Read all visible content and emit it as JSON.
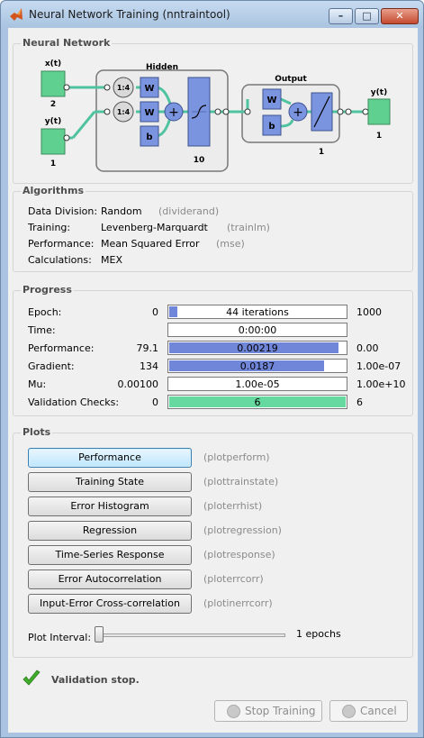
{
  "window": {
    "title": "Neural Network Training (nntraintool)",
    "controls": {
      "minimize": "–",
      "maximize": "□",
      "close": "✕"
    }
  },
  "neural_network": {
    "section_title": "Neural Network",
    "inputs": [
      {
        "label": "x(t)",
        "size": "2"
      },
      {
        "label": "y(t)",
        "size": "1"
      }
    ],
    "hidden": {
      "title": "Hidden",
      "delays": [
        "1:4",
        "1:4"
      ],
      "weight_label": "W",
      "bias_label": "b",
      "size": "10"
    },
    "output_layer": {
      "title": "Output",
      "weight_label": "W",
      "bias_label": "b",
      "size": "1"
    },
    "output": {
      "label": "y(t)",
      "size": "1"
    },
    "colors": {
      "node_green": "#5fd08f",
      "block_blue": "#7b94e0",
      "line_teal": "#4fc3a0"
    }
  },
  "algorithms": {
    "section_title": "Algorithms",
    "rows": [
      {
        "label": "Data Division:",
        "value": "Random",
        "fn": "(dividerand)"
      },
      {
        "label": "Training:",
        "value": "Levenberg-Marquardt",
        "fn": "(trainlm)"
      },
      {
        "label": "Performance:",
        "value": "Mean Squared Error",
        "fn": "(mse)"
      },
      {
        "label": "Calculations:",
        "value": "MEX",
        "fn": ""
      }
    ]
  },
  "progress": {
    "section_title": "Progress",
    "rows": [
      {
        "label": "Epoch:",
        "start": "0",
        "bar_text": "44 iterations",
        "fill": 0.045,
        "end": "1000",
        "color": "blue"
      },
      {
        "label": "Time:",
        "start": "",
        "bar_text": "0:00:00",
        "fill": 0,
        "end": "",
        "color": "blue"
      },
      {
        "label": "Performance:",
        "start": "79.1",
        "bar_text": "0.00219",
        "fill": 0.96,
        "end": "0.00",
        "color": "blue"
      },
      {
        "label": "Gradient:",
        "start": "134",
        "bar_text": "0.0187",
        "fill": 0.88,
        "end": "1.00e-07",
        "color": "blue"
      },
      {
        "label": "Mu:",
        "start": "0.00100",
        "bar_text": "1.00e-05",
        "fill": 0,
        "end": "1.00e+10",
        "color": "blue"
      },
      {
        "label": "Validation Checks:",
        "start": "0",
        "bar_text": "6",
        "fill": 1.0,
        "end": "6",
        "color": "green"
      }
    ]
  },
  "plots": {
    "section_title": "Plots",
    "buttons": [
      {
        "label": "Performance",
        "fn": "(plotperform)"
      },
      {
        "label": "Training State",
        "fn": "(plottrainstate)"
      },
      {
        "label": "Error Histogram",
        "fn": "(ploterrhist)"
      },
      {
        "label": "Regression",
        "fn": "(plotregression)"
      },
      {
        "label": "Time-Series Response",
        "fn": "(plotresponse)"
      },
      {
        "label": "Error Autocorrelation",
        "fn": "(ploterrcorr)"
      },
      {
        "label": "Input-Error Cross-correlation",
        "fn": "(plotinerrcorr)"
      }
    ],
    "interval_label": "Plot Interval:",
    "interval_value": "1 epochs",
    "slider_value": 1
  },
  "status": {
    "message": "Validation stop.",
    "stop_button": "Stop Training",
    "cancel_button": "Cancel"
  }
}
